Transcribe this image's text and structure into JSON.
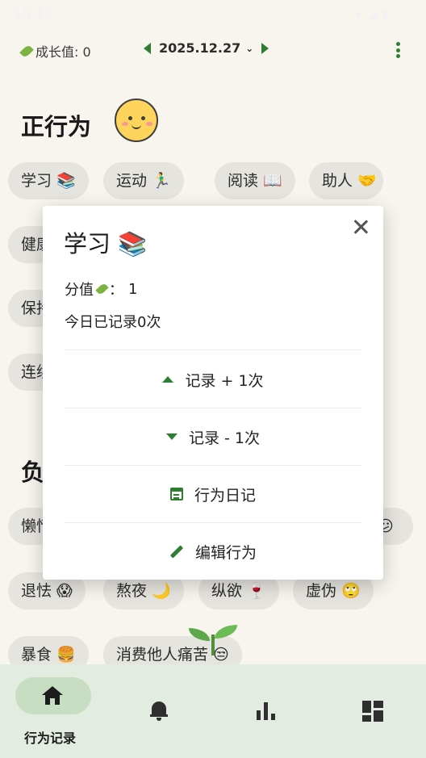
{
  "status_bar": {
    "time": "10:17",
    "icons": "▾◢▮"
  },
  "header": {
    "growth_label": "成长值: 0",
    "date": "2025.12.27",
    "prev_icon": "chevron-left-icon",
    "next_icon": "chevron-right-icon",
    "menu_icon": "more-vert-icon"
  },
  "positive_section": {
    "title": "正行为",
    "chips": [
      "学习 📚",
      "运动 🏃‍♂",
      "阅读 📖",
      "助人 🤝",
      "健康饮食",
      "保持卫生",
      "连续打卡"
    ]
  },
  "negative_section": {
    "title": "负",
    "chips": [
      "懒惰",
      "😕",
      "退怯 😱",
      "熬夜 🌙",
      "纵欲 🍷",
      "虚伪 🙄",
      "暴食 🍔",
      "消费他人痛苦 😒"
    ]
  },
  "dialog": {
    "title": "学习 📚",
    "score_label": "分值",
    "score_sep": "：",
    "score_value": "1",
    "today_count": "今日已记录0次",
    "actions": {
      "increase": "记录 + 1次",
      "decrease": "记录 - 1次",
      "diary": "行为日记",
      "edit": "编辑行为"
    }
  },
  "bottom_nav": {
    "active_label": "行为记录",
    "items": [
      "home-icon",
      "bell-icon",
      "bar-chart-icon",
      "dashboard-icon"
    ]
  },
  "colors": {
    "accent": "#2e7d32",
    "background": "#f7f5ee",
    "chip": "#e6e4de",
    "nav_bg": "#e3ece0",
    "nav_active": "#c7dec2"
  }
}
